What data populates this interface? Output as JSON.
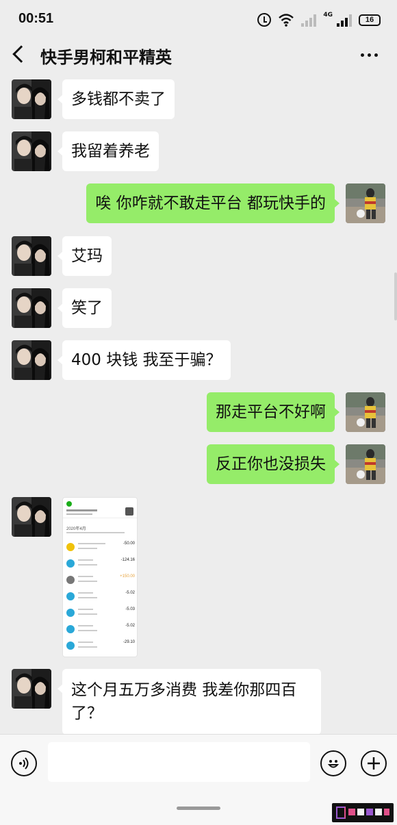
{
  "status_bar": {
    "time": "00:51",
    "network": "4G",
    "battery": "16"
  },
  "header": {
    "title": "快手男柯和平精英"
  },
  "messages": [
    {
      "side": "left",
      "type": "text",
      "text": "多钱都不卖了"
    },
    {
      "side": "left",
      "type": "text",
      "text": "我留着养老"
    },
    {
      "side": "right",
      "type": "text",
      "text": "唉 你咋就不敢走平台 都玩快手的"
    },
    {
      "side": "left",
      "type": "text",
      "text": "艾玛"
    },
    {
      "side": "left",
      "type": "text",
      "text": "笑了"
    },
    {
      "side": "left",
      "type": "text",
      "text": "400 块钱 我至于骗？"
    },
    {
      "side": "right",
      "type": "text",
      "text": "那走平台不好啊"
    },
    {
      "side": "right",
      "type": "text",
      "text": "反正你也没损失"
    },
    {
      "side": "left",
      "type": "image",
      "text": ""
    },
    {
      "side": "left",
      "type": "text",
      "text": "这个月五万多消费 我差你那四百了？"
    }
  ],
  "screenshot": {
    "month": "2020年4月",
    "rows": [
      {
        "amount": "-50.00",
        "color": "#f0c20a"
      },
      {
        "amount": "-124.16",
        "color": "#2aa8d8"
      },
      {
        "amount": "+150.00",
        "color": "#777777"
      },
      {
        "amount": "-5.02",
        "color": "#2aa8d8"
      },
      {
        "amount": "-5.03",
        "color": "#2aa8d8"
      },
      {
        "amount": "-5.02",
        "color": "#2aa8d8"
      },
      {
        "amount": "-29.10",
        "color": "#2aa8d8"
      }
    ]
  },
  "input_bar": {
    "voice_icon": "voice-icon",
    "emoji_icon": "emoji-icon",
    "plus_icon": "plus-icon"
  },
  "colors": {
    "background": "#ededed",
    "self_bubble": "#95ec69",
    "other_bubble": "#ffffff"
  }
}
